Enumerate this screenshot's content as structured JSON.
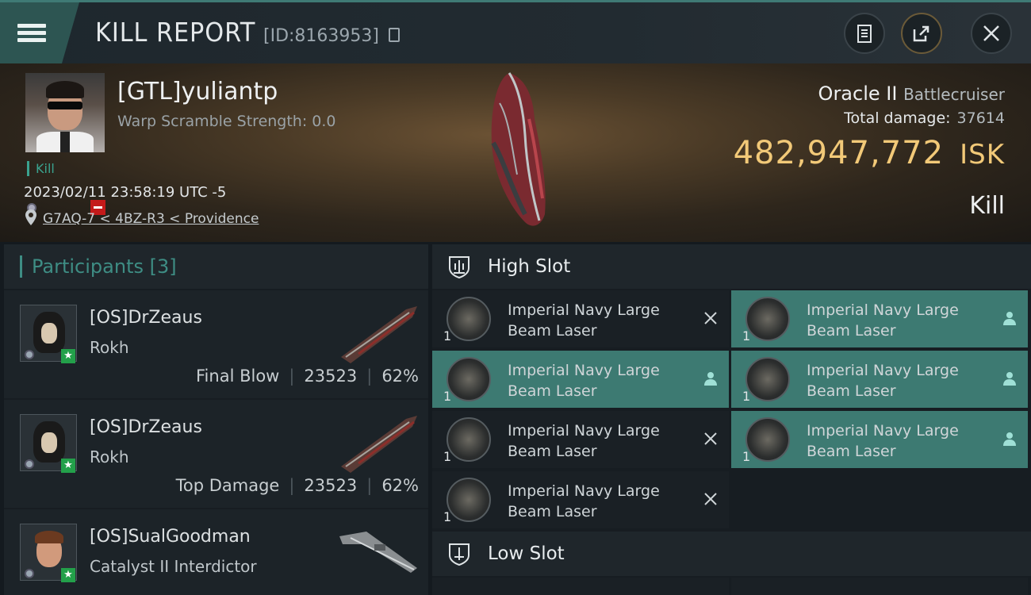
{
  "header": {
    "title": "KILL REPORT",
    "report_id": "[ID:8163953]"
  },
  "victim": {
    "name": "[GTL]yuliantp",
    "warp_scramble": "Warp Scramble Strength: 0.0",
    "tag": "Kill",
    "timestamp": "2023/02/11 23:58:19 UTC -5",
    "location": "G7AQ-7 < 4BZ-R3 < Providence",
    "ship_name": "Oracle II",
    "ship_class": "Battlecruiser",
    "total_damage_label": "Total damage:",
    "total_damage": "37614",
    "isk_value": "482,947,772",
    "isk_unit": "ISK",
    "report_type": "Kill"
  },
  "participants": {
    "label": "Participants",
    "count": "[3]",
    "items": [
      {
        "name": "[OS]DrZeaus",
        "ship": "Rokh",
        "role": "Final Blow",
        "damage": "23523",
        "percent": "62%"
      },
      {
        "name": "[OS]DrZeaus",
        "ship": "Rokh",
        "role": "Top Damage",
        "damage": "23523",
        "percent": "62%"
      },
      {
        "name": "[OS]SualGoodman",
        "ship": "Catalyst II Interdictor"
      }
    ]
  },
  "high_slot": {
    "label": "High Slot",
    "modules": [
      {
        "line1": "Imperial Navy Large",
        "line2": "Beam Laser",
        "qty": "1",
        "state": "destroyed"
      },
      {
        "line1": "Imperial Navy Large",
        "line2": "Beam Laser",
        "qty": "1",
        "state": "dropped"
      },
      {
        "line1": "Imperial Navy Large",
        "line2": "Beam Laser",
        "qty": "1",
        "state": "dropped"
      },
      {
        "line1": "Imperial Navy Large",
        "line2": "Beam Laser",
        "qty": "1",
        "state": "dropped"
      },
      {
        "line1": "Imperial Navy Large",
        "line2": "Beam Laser",
        "qty": "1",
        "state": "destroyed"
      },
      {
        "line1": "Imperial Navy Large",
        "line2": "Beam Laser",
        "qty": "1",
        "state": "dropped"
      },
      {
        "line1": "Imperial Navy Large",
        "line2": "Beam Laser",
        "qty": "1",
        "state": "destroyed"
      }
    ]
  },
  "low_slot": {
    "label": "Low Slot"
  },
  "colors": {
    "accent": "#3e8d84",
    "isk": "#f2c978",
    "highlight": "#3d7a72",
    "danger": "#c41a1a"
  }
}
